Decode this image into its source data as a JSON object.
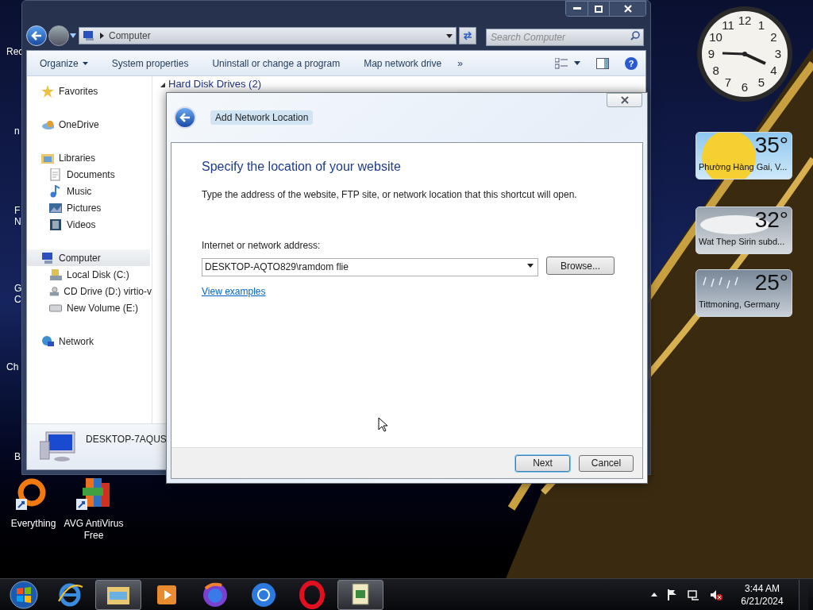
{
  "desktop_edge_labels": [
    "Rec",
    "n",
    "F",
    "N",
    "G",
    "C",
    "Ch",
    "B"
  ],
  "desktop_icons": [
    {
      "label": "Everything"
    },
    {
      "label": "AVG AntiVirus Free"
    }
  ],
  "explorer": {
    "address": {
      "path": "Computer"
    },
    "search": {
      "placeholder": "Search Computer"
    },
    "toolbar": [
      {
        "label": "Organize",
        "dropdown": true
      },
      {
        "label": "System properties",
        "dropdown": false
      },
      {
        "label": "Uninstall or change a program",
        "dropdown": false
      },
      {
        "label": "Map network drive",
        "dropdown": false
      },
      {
        "label": "»",
        "dropdown": false
      }
    ],
    "help": "?",
    "nav": [
      {
        "label": "Favorites",
        "selected": false
      },
      {
        "label": "OneDrive",
        "selected": false
      },
      {
        "label": "Libraries",
        "selected": false,
        "children": [
          {
            "label": "Documents",
            "selected": false
          },
          {
            "label": "Music",
            "selected": false
          },
          {
            "label": "Pictures",
            "selected": false
          },
          {
            "label": "Videos",
            "selected": false
          }
        ]
      },
      {
        "label": "Computer",
        "selected": true,
        "children": [
          {
            "label": "Local Disk (C:)",
            "selected": false
          },
          {
            "label": "CD Drive (D:) virtio-v",
            "selected": false
          },
          {
            "label": "New Volume (E:)",
            "selected": false
          }
        ]
      },
      {
        "label": "Network",
        "selected": false
      }
    ],
    "section_heading": "Hard Disk Drives (2)",
    "details": {
      "name": "DESKTOP-7AQUS"
    }
  },
  "dialog": {
    "title": "Add Network Location",
    "heading": "Specify the location of your website",
    "description": "Type the address of the website, FTP site, or network location that this shortcut will open.",
    "field_label": "Internet or network address:",
    "field_value": "DESKTOP-AQTO829\\ramdom flie",
    "browse": "Browse...",
    "link": "View examples",
    "buttons": [
      {
        "label": "Next",
        "default": true
      },
      {
        "label": "Cancel",
        "default": false
      }
    ]
  },
  "clock": {
    "numerals": [
      "12",
      "11",
      "1",
      "10",
      "2",
      "9",
      "3",
      "8",
      "4",
      "7",
      "5",
      "6"
    ]
  },
  "weather": [
    {
      "temp": "35°",
      "place": "Phường Hàng Gai, V...",
      "kind": "sunny"
    },
    {
      "temp": "32°",
      "place": "Wat Thep Sirin subd...",
      "kind": "cloudy"
    },
    {
      "temp": "25°",
      "place": "Tittmoning, Germany",
      "kind": "rain"
    }
  ],
  "taskbar": [
    {
      "active": false
    },
    {
      "active": false
    },
    {
      "active": true
    },
    {
      "active": false
    },
    {
      "active": false
    },
    {
      "active": false
    },
    {
      "active": false
    },
    {
      "active": true
    }
  ],
  "tray": {
    "time": "3:44 AM",
    "date": "6/21/2024"
  }
}
